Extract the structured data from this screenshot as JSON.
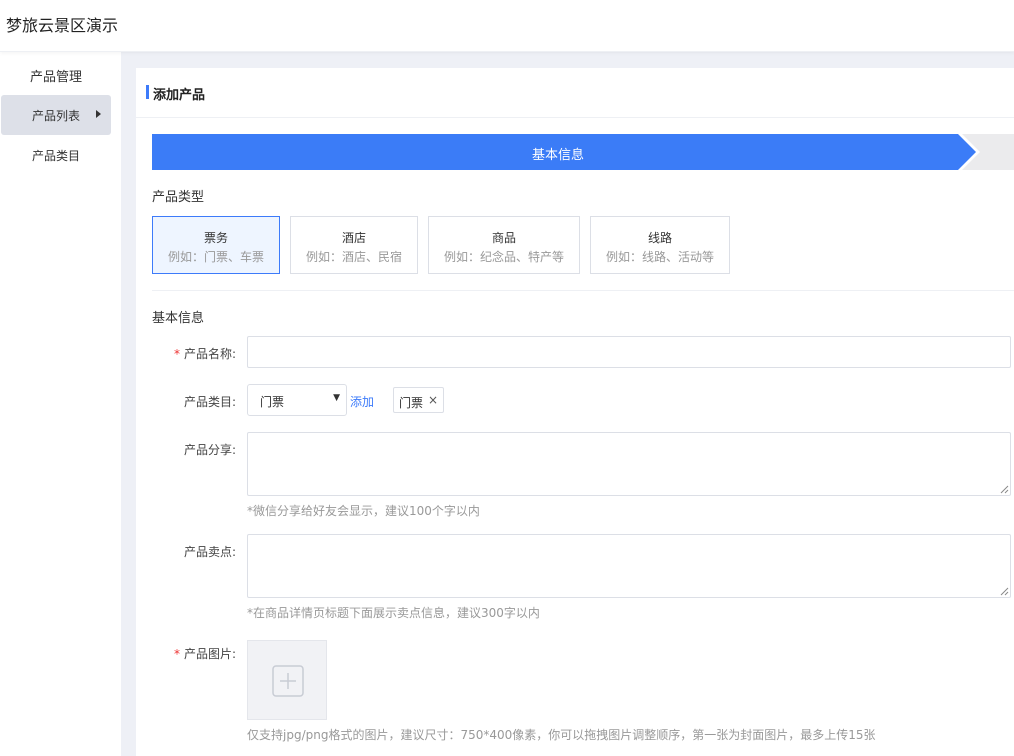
{
  "app": {
    "title": "梦旅云景区演示"
  },
  "sidebar": {
    "group_title": "产品管理",
    "items": [
      {
        "label": "产品列表",
        "active": true
      },
      {
        "label": "产品类目",
        "active": false
      }
    ]
  },
  "page": {
    "title": "添加产品",
    "steps": [
      {
        "label": "基本信息",
        "active": true
      },
      {
        "label": "",
        "active": false
      }
    ]
  },
  "product_type": {
    "section_label": "产品类型",
    "selected": "票务",
    "options": [
      {
        "name": "票务",
        "example": "例如：门票、车票"
      },
      {
        "name": "酒店",
        "example": "例如：酒店、民宿"
      },
      {
        "name": "商品",
        "example": "例如：纪念品、特产等"
      },
      {
        "name": "线路",
        "example": "例如：线路、活动等"
      }
    ]
  },
  "basic_info": {
    "section_label": "基本信息",
    "required_mark": "*",
    "name": {
      "label": "产品名称:",
      "value": "",
      "required": true
    },
    "category": {
      "label": "产品类目:",
      "selected": "门票",
      "add_link": "添加",
      "tag": "门票",
      "tag_close": "×"
    },
    "share": {
      "label": "产品分享:",
      "value": "",
      "hint": "*微信分享给好友会显示，建议100个字以内"
    },
    "selling_point": {
      "label": "产品卖点:",
      "value": "",
      "hint": "*在商品详情页标题下面展示卖点信息，建议300字以内"
    },
    "images": {
      "label": "产品图片:",
      "required": true,
      "hint": "仅支持jpg/png格式的图片，建议尺寸：750*400像素，你可以拖拽图片调整顺序，第一张为封面图片，最多上传15张"
    }
  },
  "colors": {
    "primary": "#3b7cf7",
    "required": "#e33333",
    "hint": "#999999"
  },
  "icons": {
    "submenu_arrow": "caret-right-icon",
    "select_caret": "caret-down-icon",
    "upload": "plus-icon",
    "tag_close": "close-icon"
  }
}
